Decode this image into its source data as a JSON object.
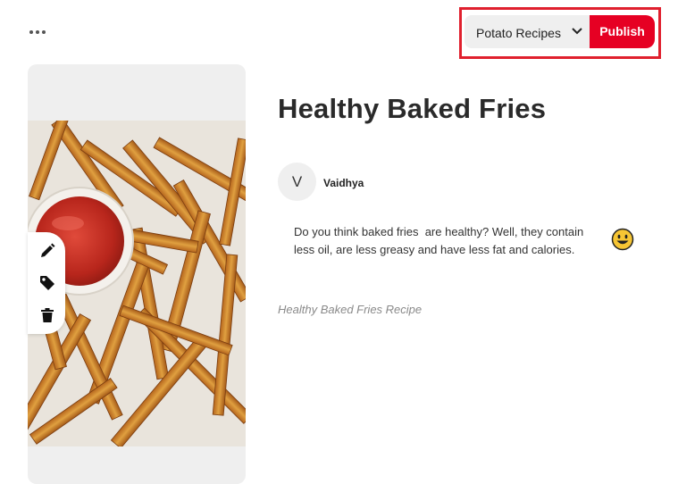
{
  "toolbar": {
    "more_icon": "more-horizontal-icon",
    "board_select": {
      "label": "Potato Recipes",
      "icon": "chevron-down-icon"
    },
    "publish_label": "Publish",
    "highlight_color": "#e0202e",
    "publish_color": "#e60023"
  },
  "image_tools": [
    {
      "name": "edit-pencil-icon"
    },
    {
      "name": "tag-icon"
    },
    {
      "name": "trash-icon"
    }
  ],
  "pin": {
    "title": "Healthy Baked Fries",
    "author": {
      "initial": "V",
      "name": "Vaidhya"
    },
    "description": "Do you think baked fries  are healthy? Well, they contain less oil, are less greasy and have less fat and calories.",
    "emoji_icon": "smiley-emoji-icon",
    "alt_text": "Healthy Baked Fries Recipe"
  }
}
